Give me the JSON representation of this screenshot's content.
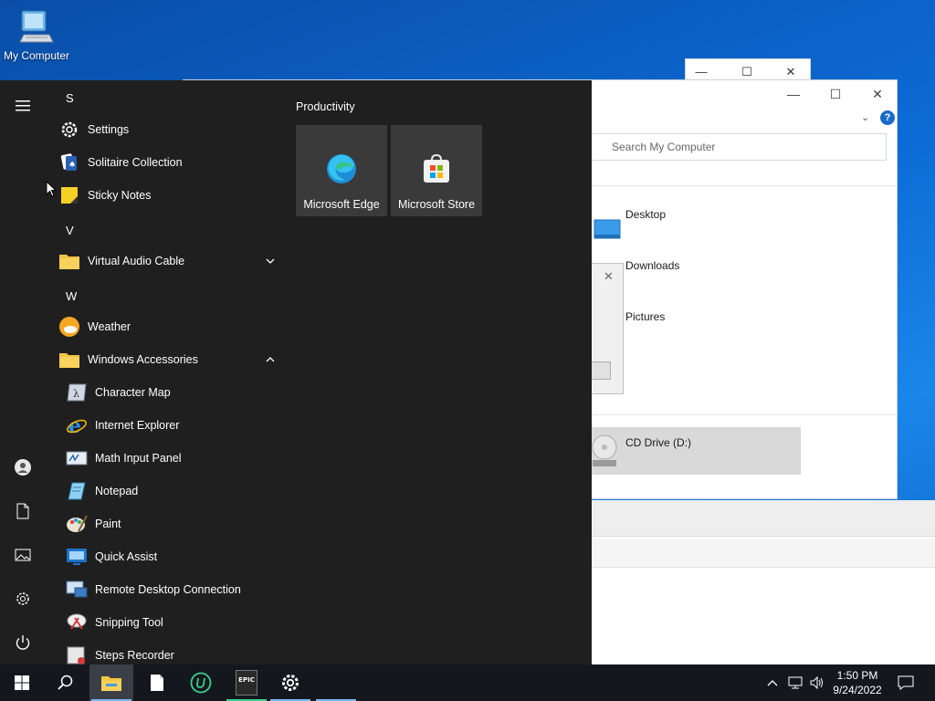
{
  "desktop": {
    "icon_label": "My Computer"
  },
  "explorer": {
    "search_placeholder": "Search My Computer",
    "folders": [
      "Desktop",
      "Downloads",
      "Pictures"
    ],
    "drive_label": "CD Drive (D:)",
    "help_glyph": "?"
  },
  "start_menu": {
    "groups": [
      {
        "letter": "S",
        "apps": [
          "Settings",
          "Solitaire Collection",
          "Sticky Notes"
        ]
      },
      {
        "letter": "V",
        "apps": [
          "Virtual Audio Cable"
        ]
      },
      {
        "letter": "W",
        "apps": [
          "Weather",
          "Windows Accessories"
        ]
      }
    ],
    "accessories": [
      "Character Map",
      "Internet Explorer",
      "Math Input Panel",
      "Notepad",
      "Paint",
      "Quick Assist",
      "Remote Desktop Connection",
      "Snipping Tool",
      "Steps Recorder"
    ],
    "tiles_header": "Productivity",
    "tiles": [
      "Microsoft Edge",
      "Microsoft Store"
    ]
  },
  "taskbar": {
    "time": "1:50 PM",
    "date": "9/24/2022",
    "epic_label": "EPIC"
  },
  "colors": {
    "accent": "#0078d7",
    "start_bg": "#1f1f1f",
    "taskbar_bg": "#14181e",
    "tile_bg": "#3a3a3a",
    "folder": "#f4c542"
  }
}
